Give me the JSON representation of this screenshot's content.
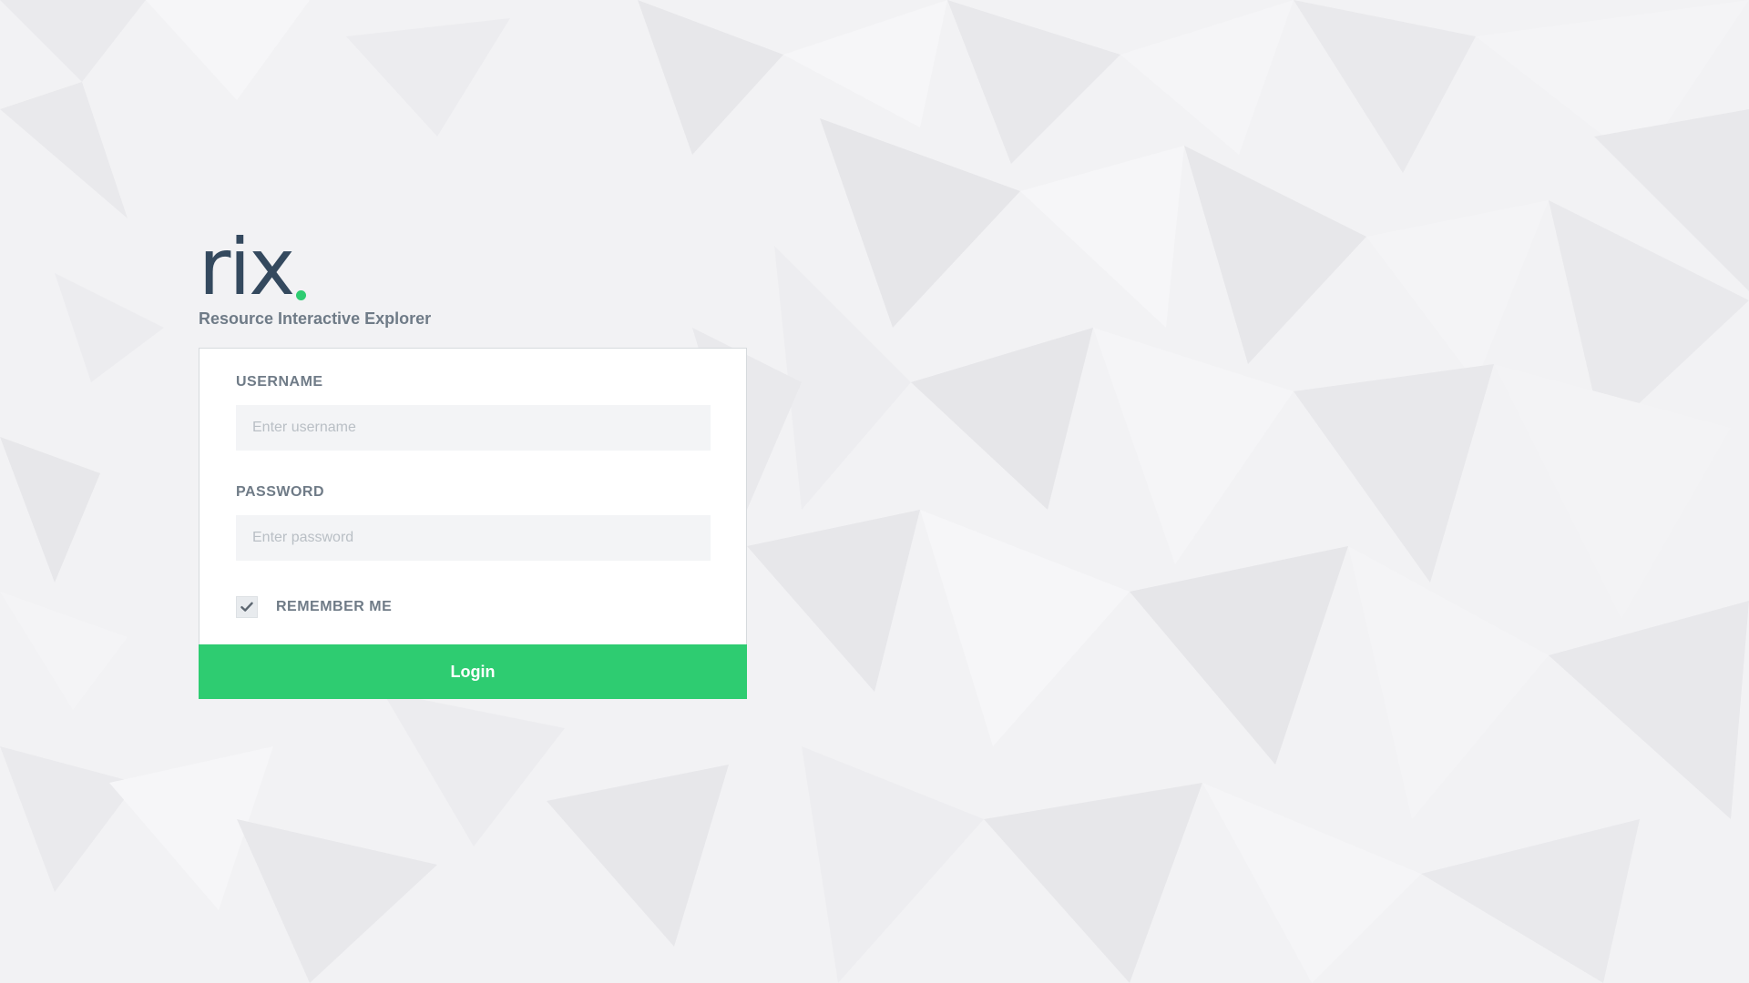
{
  "brand": {
    "logo_text": "rix",
    "subtitle": "Resource Interactive Explorer"
  },
  "form": {
    "username": {
      "label": "USERNAME",
      "placeholder": "Enter username",
      "value": ""
    },
    "password": {
      "label": "PASSWORD",
      "placeholder": "Enter password",
      "value": ""
    },
    "remember": {
      "label": "REMEMBER ME",
      "checked": true
    },
    "login_label": "Login"
  },
  "colors": {
    "accent": "#2ecc71",
    "logo_text": "#34495e",
    "label": "#6f7b87",
    "input_bg": "#f3f4f6",
    "page_bg": "#f2f2f4"
  },
  "icons": {
    "remember_check": "check-icon"
  }
}
